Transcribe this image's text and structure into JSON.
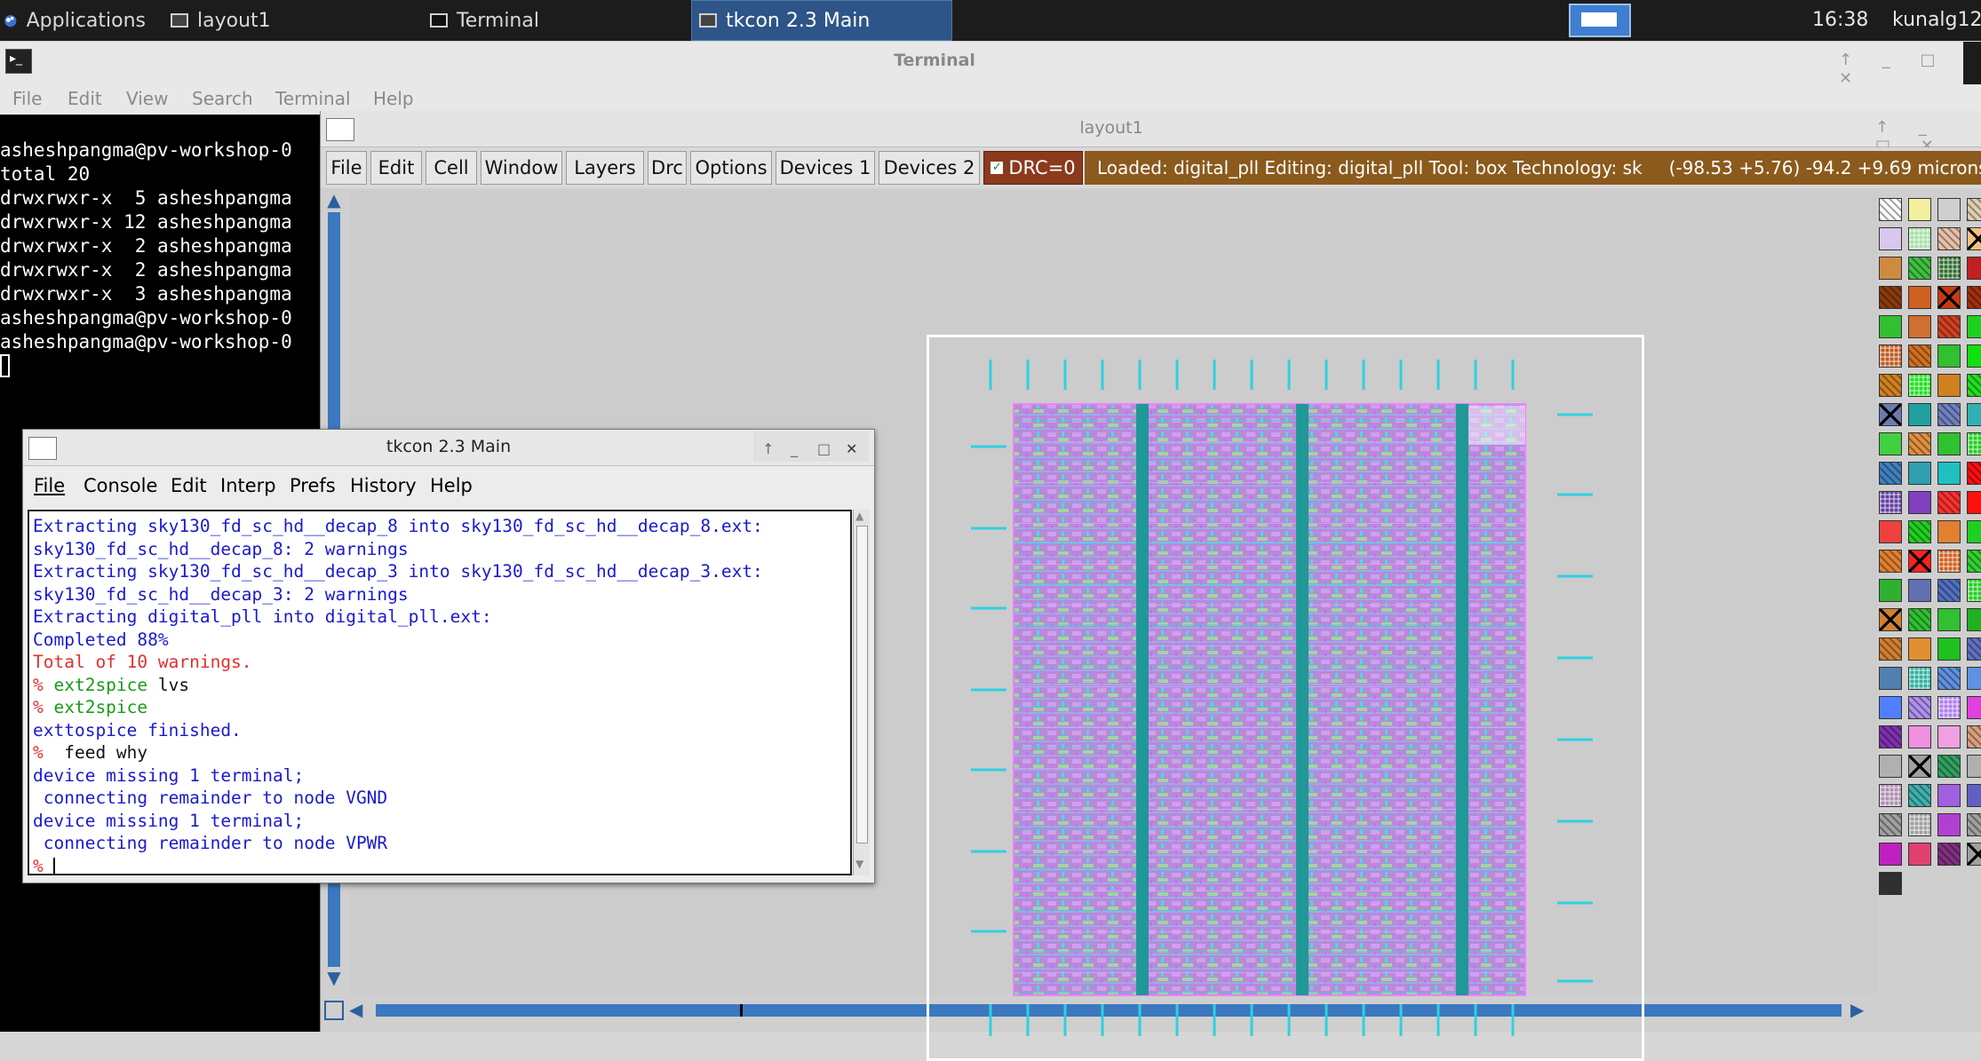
{
  "taskbar": {
    "applications": "Applications",
    "tasks": [
      "layout1",
      "Terminal",
      "tkcon 2.3 Main"
    ],
    "clock": "16:38",
    "user": "kunalg12"
  },
  "terminal": {
    "title": "Terminal",
    "menu": [
      "File",
      "Edit",
      "View",
      "Search",
      "Terminal",
      "Help"
    ],
    "lines": [
      "asheshpangma@pv-workshop-0",
      "total 20",
      "drwxrwxr-x  5 asheshpangma",
      "drwxrwxr-x 12 asheshpangma",
      "drwxrwxr-x  2 asheshpangma",
      "drwxrwxr-x  2 asheshpangma",
      "drwxrwxr-x  3 asheshpangma",
      "asheshpangma@pv-workshop-0",
      "asheshpangma@pv-workshop-0"
    ]
  },
  "magic": {
    "title": "layout1",
    "menu": [
      "File",
      "Edit",
      "Cell",
      "Window",
      "Layers",
      "Drc",
      "Options",
      "Devices 1",
      "Devices 2"
    ],
    "drc": "DRC=0",
    "status": "Loaded: digital_pll Editing: digital_pll Tool: box  Technology: sk",
    "coords": "(-98.53 +5.76) -94.2 +9.69 microns"
  },
  "tkcon": {
    "title": "tkcon 2.3 Main",
    "menu": [
      "File",
      "Console",
      "Edit",
      "Interp",
      "Prefs",
      "History",
      "Help"
    ],
    "lines": [
      {
        "prompt": "",
        "text": "Extracting sky130_fd_sc_hd__decap_8 into sky130_fd_sc_hd__decap_8.ext:",
        "color": "blue"
      },
      {
        "prompt": "",
        "text": "sky130_fd_sc_hd__decap_8: 2 warnings",
        "color": "blue"
      },
      {
        "prompt": "",
        "text": "Extracting sky130_fd_sc_hd__decap_3 into sky130_fd_sc_hd__decap_3.ext:",
        "color": "blue"
      },
      {
        "prompt": "",
        "text": "sky130_fd_sc_hd__decap_3: 2 warnings",
        "color": "blue"
      },
      {
        "prompt": "",
        "text": "Extracting digital_pll into digital_pll.ext:",
        "color": "blue"
      },
      {
        "prompt": "",
        "text": "Completed 88%",
        "color": "blue"
      },
      {
        "prompt": "",
        "text": "Total of 10 warnings.",
        "color": "red"
      },
      {
        "prompt": "%",
        "cmd": "ext2spice",
        "arg": " lvs"
      },
      {
        "prompt": "%",
        "cmd": "ext2spice",
        "arg": ""
      },
      {
        "prompt": "",
        "text": "exttospice finished.",
        "color": "blue"
      },
      {
        "prompt": "%",
        "cmd": "",
        "arg": " feed why"
      },
      {
        "prompt": "",
        "text": "device missing 1 terminal;",
        "color": "blue"
      },
      {
        "prompt": "",
        "text": " connecting remainder to node VGND",
        "color": "blue"
      },
      {
        "prompt": "",
        "text": "device missing 1 terminal;",
        "color": "blue"
      },
      {
        "prompt": "",
        "text": " connecting remainder to node VPWR",
        "color": "blue"
      },
      {
        "prompt": "%",
        "cmd": "",
        "arg": ""
      }
    ]
  },
  "palette": {
    "colors": [
      "#ffffff",
      "#f4f0a0",
      "#cfcfcf",
      "#e0d0b0",
      "#d8c8f0",
      "#a8e0a8",
      "#e8c0a8",
      "#f0c080",
      "#d08a40",
      "#40c040",
      "#2f6f2f",
      "#c02020",
      "#8a3a0a",
      "#d06020",
      "#c83a10",
      "#a03010",
      "#30c030",
      "#d07030",
      "#d04020",
      "#20d020",
      "#c05a20",
      "#d07020",
      "#30c030",
      "#10e010",
      "#d08020",
      "#20e020",
      "#d08020",
      "#20e020",
      "#6a7ab0",
      "#20a0a0",
      "#7080c0",
      "#30b0b0",
      "#40d040",
      "#e09040",
      "#30c030",
      "#20d020",
      "#4080c0",
      "#30a0b0",
      "#20c0c0",
      "#ff1010",
      "#6040a0",
      "#8040c0",
      "#ff3030",
      "#ff1010",
      "#f04040",
      "#20d020",
      "#e08030",
      "#20d020",
      "#e08030",
      "#ff2020",
      "#d06020",
      "#30d030",
      "#30b030",
      "#6070b0",
      "#5070c0",
      "#20d020",
      "#d08030",
      "#30c030",
      "#30c030",
      "#20b020",
      "#d08030",
      "#e09030",
      "#20c020",
      "#6070c0",
      "#5080b0",
      "#30b0a0",
      "#6090e0",
      "#6090e0",
      "#5080ff",
      "#b090f0",
      "#b080f0",
      "#e040e0",
      "#8030b0",
      "#f090e0",
      "#f0a0e0",
      "#d8a080",
      "#b0b0b0",
      "#a0a0a0",
      "#30a060",
      "#b0b0b0",
      "#b090b0",
      "#40b0b0",
      "#a060e0",
      "#6060c0",
      "#a0a0a0",
      "#a0a0a0",
      "#b040d0",
      "#a0a0a0",
      "#c020c0",
      "#e04070",
      "#803080",
      "#a0a0a0",
      "#303030"
    ]
  }
}
